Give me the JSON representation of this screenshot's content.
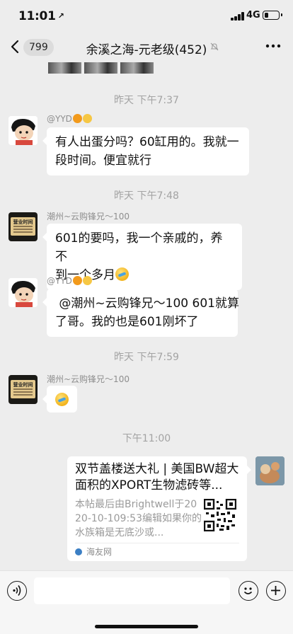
{
  "status_bar": {
    "time": "11:01",
    "location_arrow": "↗",
    "network": "4G",
    "battery_level": 0.3
  },
  "nav": {
    "back_icon": "chevron-left-icon",
    "unread_count": "799",
    "title": "余溪之海-元老级(452)",
    "mute_icon": "bell-off-icon",
    "more_icon": "ellipsis-icon"
  },
  "messages": [
    {
      "type": "time",
      "text": "昨天 下午7:37"
    },
    {
      "type": "text",
      "sender": "@YYD",
      "avatar": "cartoon-avatar",
      "text_line1": "有人出蛋分吗？60缸用的。我就一",
      "text_line2": "段时间。便宜就行"
    },
    {
      "type": "time",
      "text": "昨天 下午7:48"
    },
    {
      "type": "text",
      "sender": "潮州~云购锋兄～100",
      "avatar": "shop-sign-avatar",
      "text_line1": "601的要吗，我一个亲戚的，养不",
      "text_line2": "到一个多月"
    },
    {
      "type": "text",
      "sender": "@YYD",
      "avatar": "cartoon-avatar",
      "text_line1": " @潮州~云购锋兄～100 601就算",
      "text_line2": "了哥。我的也是601刚坏了"
    },
    {
      "type": "time",
      "text": "昨天 下午7:59"
    },
    {
      "type": "emoji",
      "sender": "潮州~云购锋兄～100",
      "avatar": "shop-sign-avatar"
    },
    {
      "type": "time",
      "text": "下午11:00"
    },
    {
      "type": "link",
      "title": "双节盖楼送大礼 | 美国BW超大面积的XPORT生物滤砖等...",
      "description": "本帖最后由Brightwell于2020-10-109:53编辑如果你的水族箱是无底沙或...",
      "source": "海友网"
    }
  ],
  "avatar_sign_text": "营业时间",
  "input_bar": {
    "placeholder": "",
    "voice_icon": "voice-icon",
    "emoji_icon": "emoji-icon",
    "plus_icon": "plus-icon"
  },
  "colors": {
    "background": "#ededed",
    "bubble": "#ffffff",
    "timestamp": "#a3a3a3"
  }
}
